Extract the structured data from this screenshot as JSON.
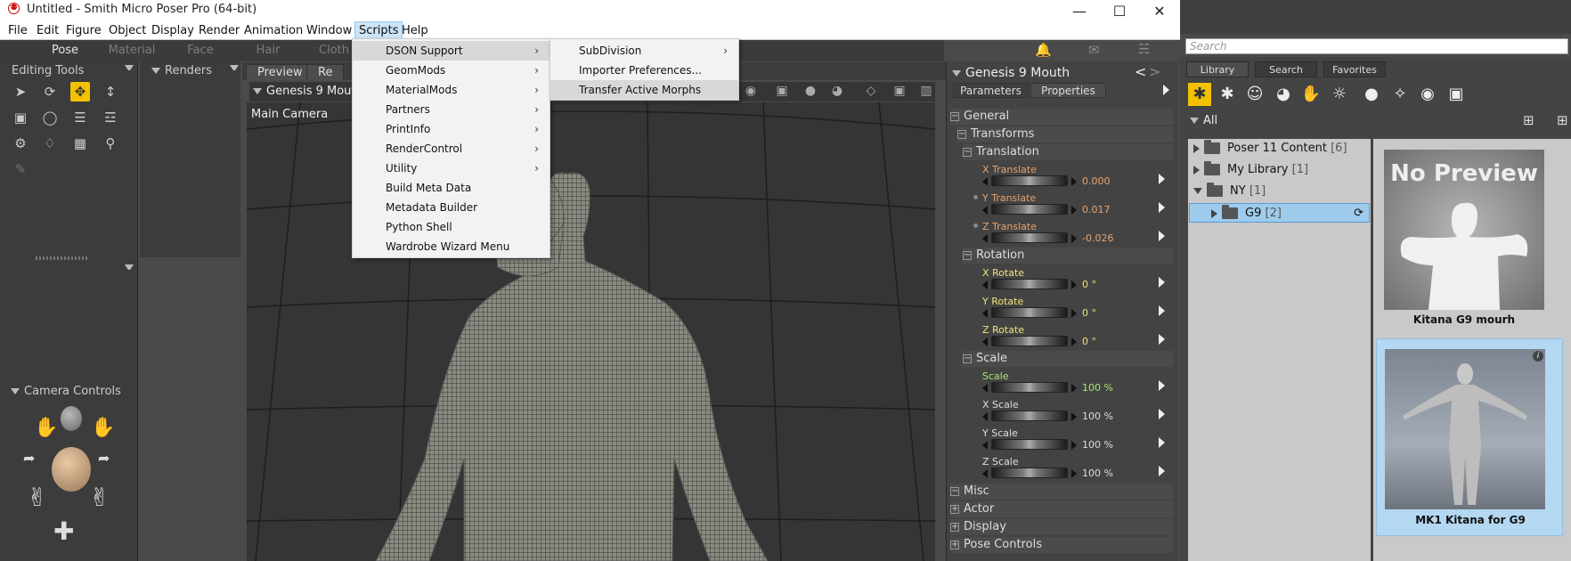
{
  "window": {
    "title": "Untitled - Smith Micro Poser Pro  (64-bit)",
    "icons": [
      "minimize-icon",
      "maximize-icon",
      "close-icon"
    ]
  },
  "menubar": [
    "File",
    "Edit",
    "Figure",
    "Object",
    "Display",
    "Render",
    "Animation",
    "Window",
    "Scripts",
    "Help"
  ],
  "rooms": [
    "Pose",
    "Material",
    "Face",
    "Hair",
    "Cloth"
  ],
  "left_panel": {
    "editing_tools_title": "Editing Tools",
    "renders_title": "Renders",
    "camera_controls_title": "Camera Controls"
  },
  "viewport": {
    "tabs": [
      "Preview",
      "Re"
    ],
    "actor_select": "Genesis 9 Mouth",
    "camera_label": "Main Camera"
  },
  "scripts_menu": {
    "items": [
      {
        "label": "DSON Support",
        "submenu": true
      },
      {
        "label": "GeomMods",
        "submenu": true
      },
      {
        "label": "MaterialMods",
        "submenu": true
      },
      {
        "label": "Partners",
        "submenu": true
      },
      {
        "label": "PrintInfo",
        "submenu": true
      },
      {
        "label": "RenderControl",
        "submenu": true
      },
      {
        "label": "Utility",
        "submenu": true
      },
      {
        "label": "Build Meta Data",
        "submenu": false
      },
      {
        "label": "Metadata Builder",
        "submenu": false
      },
      {
        "label": "Python Shell",
        "submenu": false
      },
      {
        "label": "Wardrobe Wizard Menu",
        "submenu": false
      }
    ]
  },
  "dson_submenu": {
    "items": [
      {
        "label": "SubDivision",
        "submenu": true
      },
      {
        "label": "Importer Preferences...",
        "submenu": false
      },
      {
        "label": "Transfer Active Morphs",
        "submenu": false
      }
    ]
  },
  "params": {
    "title": "Genesis 9 Mouth",
    "tabs": [
      "Parameters",
      "Properties"
    ],
    "groups": {
      "general": "General",
      "transforms": "Transforms",
      "translation": "Translation",
      "rotation": "Rotation",
      "scale": "Scale",
      "misc": "Misc",
      "actor": "Actor",
      "display": "Display",
      "pose_controls": "Pose Controls"
    },
    "dials": [
      {
        "label": "X Translate",
        "value": "0.000"
      },
      {
        "label": "Y Translate",
        "value": "0.017"
      },
      {
        "label": "Z Translate",
        "value": "-0.026"
      },
      {
        "label": "X Rotate",
        "value": "0 °"
      },
      {
        "label": "Y Rotate",
        "value": "0 °"
      },
      {
        "label": "Z Rotate",
        "value": "0 °"
      },
      {
        "label": "Scale",
        "value": "100 %"
      },
      {
        "label": "X Scale",
        "value": "100 %"
      },
      {
        "label": "Y Scale",
        "value": "100 %"
      },
      {
        "label": "Z Scale",
        "value": "100 %"
      }
    ]
  },
  "library": {
    "search_placeholder": "Search",
    "tabs": [
      "Library",
      "Search",
      "Favorites"
    ],
    "filter": "All",
    "tree": [
      {
        "name": "Poser 11 Content",
        "count": "[6]"
      },
      {
        "name": "My Library",
        "count": "[1]"
      },
      {
        "name": "NY",
        "count": "[1]"
      },
      {
        "name": "G9",
        "count": "[2]"
      }
    ],
    "thumbs": [
      {
        "caption": "Kitana G9 mourh",
        "preview_text": "No Preview"
      },
      {
        "caption": "MK1 Kitana for G9"
      }
    ]
  },
  "colors": {
    "accent": "#f2c200",
    "selection": "#9fcbec",
    "panel_bg": "#434343"
  }
}
